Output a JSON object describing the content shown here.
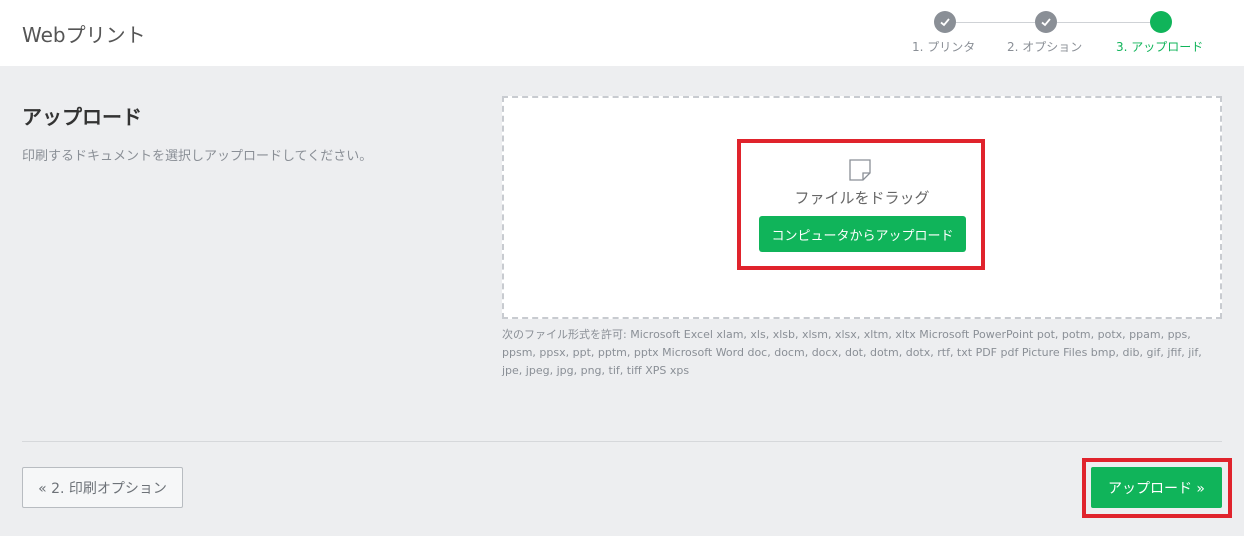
{
  "header": {
    "title": "Webプリント"
  },
  "stepper": {
    "steps": [
      {
        "label": "1. プリンタ",
        "state": "done"
      },
      {
        "label": "2. オプション",
        "state": "done"
      },
      {
        "label": "3. アップロード",
        "state": "active"
      }
    ]
  },
  "section": {
    "title": "アップロード",
    "description": "印刷するドキュメントを選択しアップロードしてください。"
  },
  "dropzone": {
    "icon": "file-icon",
    "drag_text": "ファイルをドラッグ",
    "upload_button": "コンピュータからアップロード"
  },
  "formats": {
    "text": "次のファイル形式を許可: Microsoft Excel xlam, xls, xlsb, xlsm, xlsx, xltm, xltx Microsoft PowerPoint pot, potm, potx, ppam, pps, ppsm, ppsx, ppt, pptm, pptx Microsoft Word doc, docm, docx, dot, dotm, dotx, rtf, txt PDF pdf Picture Files bmp, dib, gif, jfif, jif, jpe, jpeg, jpg, png, tif, tiff XPS xps"
  },
  "footer": {
    "back_button": "« 2. 印刷オプション",
    "next_button": "アップロード »"
  },
  "colors": {
    "accent": "#10b45a",
    "done": "#8a8f96",
    "highlight": "#e0232c"
  }
}
